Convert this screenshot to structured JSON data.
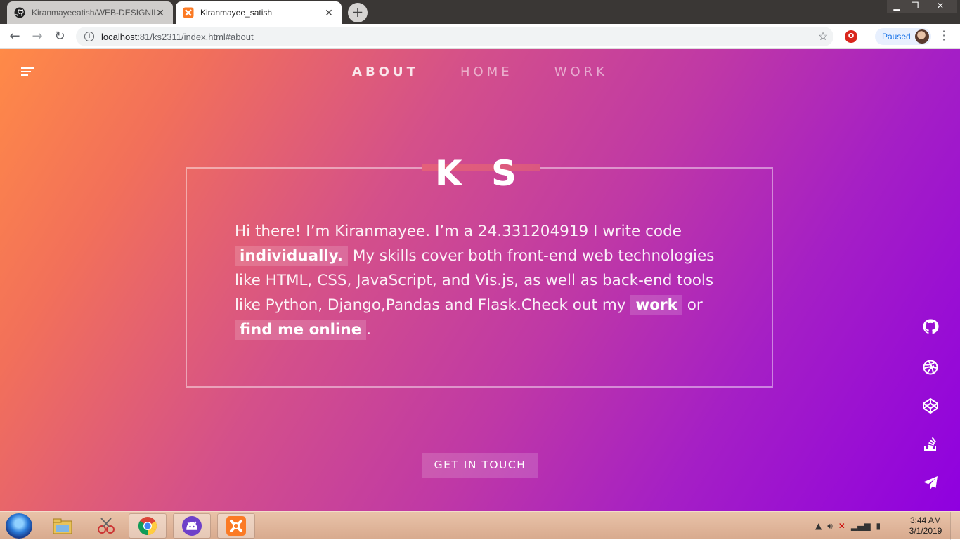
{
  "browser": {
    "tabs": [
      {
        "title": "Kiranmayeeatish/WEB-DESIGNIN",
        "icon": "github-icon",
        "active": false
      },
      {
        "title": "Kiranmayee_satish",
        "icon": "xampp-icon",
        "active": true
      }
    ],
    "url_host": "localhost",
    "url_path": ":81/ks2311/index.html#about",
    "profile_status": "Paused"
  },
  "nav": {
    "items": [
      "ABOUT",
      "HOME",
      "WORK"
    ],
    "active": "ABOUT"
  },
  "hero": {
    "monogram": "K S",
    "bio_1": "Hi there! I’m Kiranmayee. I’m a 24.331204919 I write code ",
    "bio_hl_1": "individually.",
    "bio_2": " My skills cover both front-end web technologies like HTML, CSS, JavaScript, and Vis.js, as well as back-end tools like Python, Django,Pandas and Flask.Check out my ",
    "bio_hl_2": "work",
    "bio_3": " or ",
    "bio_hl_3": "find me online",
    "bio_4": ".",
    "cta": "GET IN TOUCH"
  },
  "social": [
    "github-icon",
    "dribbble-icon",
    "codepen-icon",
    "stackoverflow-icon",
    "send-icon"
  ],
  "taskbar": {
    "apps": [
      "windows-explorer-icon",
      "snipping-tool-icon",
      "chrome-icon",
      "github-desktop-icon",
      "xampp-icon"
    ],
    "time": "3:44 AM",
    "date": "3/1/2019"
  },
  "colors": {
    "gradient_start": "#ff8a47",
    "gradient_mid": "#d4508a",
    "gradient_end": "#8f00e0"
  }
}
